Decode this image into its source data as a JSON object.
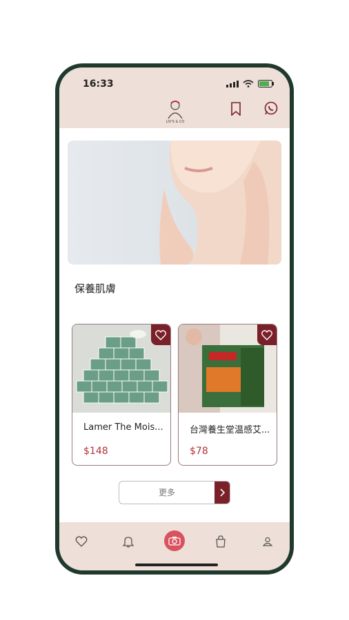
{
  "status": {
    "time": "16:33"
  },
  "header": {
    "logo_text": "LIV'S & CO"
  },
  "section": {
    "title": "保養肌膚"
  },
  "products": [
    {
      "name": "Lamer The Mois...",
      "price": "$148"
    },
    {
      "name": "台灣養生堂温感艾...",
      "price": "$78"
    }
  ],
  "more_button": {
    "label": "更多"
  },
  "colors": {
    "accent": "#7a2028",
    "appbar": "#eedfd8",
    "price": "#b3323a",
    "frame": "#1f3a2c"
  },
  "icons": [
    "heart-icon",
    "bell-icon",
    "camera-icon",
    "bag-icon",
    "user-icon",
    "bookmark-icon",
    "whatsapp-icon"
  ]
}
